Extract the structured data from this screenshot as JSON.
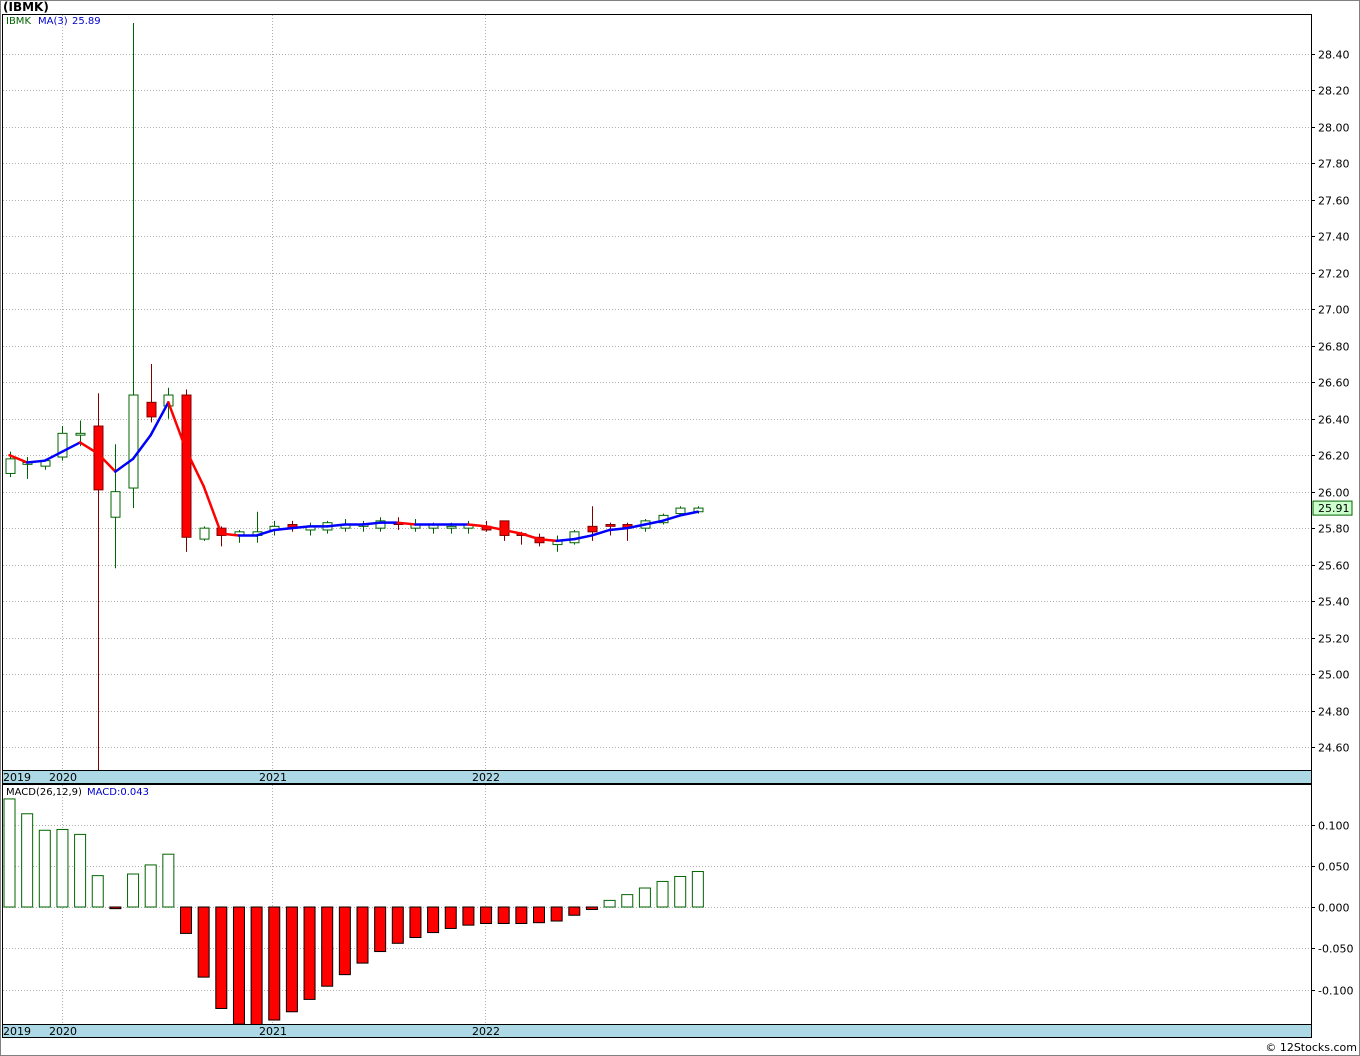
{
  "title": "(IBMK)",
  "watermark": "© 12Stocks.com",
  "colors": {
    "up_body": "#ffffff",
    "up_border": "#006400",
    "down_body": "#ff0000",
    "down_border": "#800000",
    "ma_up": "#0000ff",
    "ma_down": "#ff0000",
    "macd_pos_border": "#006400",
    "macd_neg_fill": "#ff0000",
    "grid": "#b0b0b0",
    "axis_band": "#add8e6",
    "last_price_bg": "#ccffcc"
  },
  "chart_data": [
    {
      "type": "candlestick",
      "panel": "price",
      "ticker_label": "IBMK",
      "ma_label": "MA(3)",
      "ma_value": "25.89",
      "last_price": "25.91",
      "ylim": [
        24.47,
        28.62
      ],
      "y_ticks": [
        "24.60",
        "24.80",
        "25.00",
        "25.20",
        "25.40",
        "25.60",
        "25.80",
        "26.00",
        "26.20",
        "26.40",
        "26.60",
        "26.80",
        "27.00",
        "27.20",
        "27.40",
        "27.60",
        "27.80",
        "28.00",
        "28.20",
        "28.40"
      ],
      "x_labels": [
        "2019",
        "2020",
        "2021",
        "2022"
      ],
      "grid": true,
      "candles": [
        {
          "o": 26.1,
          "h": 26.22,
          "l": 26.08,
          "c": 26.18
        },
        {
          "o": 26.15,
          "h": 26.19,
          "l": 26.07,
          "c": 26.16
        },
        {
          "o": 26.14,
          "h": 26.18,
          "l": 26.12,
          "c": 26.17
        },
        {
          "o": 26.19,
          "h": 26.36,
          "l": 26.17,
          "c": 26.32
        },
        {
          "o": 26.31,
          "h": 26.39,
          "l": 26.25,
          "c": 26.32
        },
        {
          "o": 26.36,
          "h": 26.54,
          "l": 24.47,
          "c": 26.01
        },
        {
          "o": 25.86,
          "h": 26.26,
          "l": 25.58,
          "c": 26.0
        },
        {
          "o": 26.02,
          "h": 28.57,
          "l": 25.91,
          "c": 26.53
        },
        {
          "o": 26.49,
          "h": 26.7,
          "l": 26.38,
          "c": 26.41
        },
        {
          "o": 26.47,
          "h": 26.57,
          "l": 26.4,
          "c": 26.53
        },
        {
          "o": 26.53,
          "h": 26.56,
          "l": 25.67,
          "c": 25.75
        },
        {
          "o": 25.74,
          "h": 25.81,
          "l": 25.73,
          "c": 25.8
        },
        {
          "o": 25.8,
          "h": 25.81,
          "l": 25.7,
          "c": 25.76
        },
        {
          "o": 25.76,
          "h": 25.79,
          "l": 25.72,
          "c": 25.78
        },
        {
          "o": 25.76,
          "h": 25.89,
          "l": 25.72,
          "c": 25.78
        },
        {
          "o": 25.79,
          "h": 25.84,
          "l": 25.76,
          "c": 25.81
        },
        {
          "o": 25.82,
          "h": 25.84,
          "l": 25.78,
          "c": 25.8
        },
        {
          "o": 25.79,
          "h": 25.83,
          "l": 25.76,
          "c": 25.81
        },
        {
          "o": 25.79,
          "h": 25.84,
          "l": 25.77,
          "c": 25.83
        },
        {
          "o": 25.8,
          "h": 25.85,
          "l": 25.78,
          "c": 25.82
        },
        {
          "o": 25.81,
          "h": 25.84,
          "l": 25.78,
          "c": 25.82
        },
        {
          "o": 25.8,
          "h": 25.86,
          "l": 25.78,
          "c": 25.84
        },
        {
          "o": 25.83,
          "h": 25.86,
          "l": 25.79,
          "c": 25.82
        },
        {
          "o": 25.8,
          "h": 25.85,
          "l": 25.78,
          "c": 25.82
        },
        {
          "o": 25.8,
          "h": 25.83,
          "l": 25.77,
          "c": 25.82
        },
        {
          "o": 25.8,
          "h": 25.83,
          "l": 25.77,
          "c": 25.81
        },
        {
          "o": 25.8,
          "h": 25.84,
          "l": 25.77,
          "c": 25.82
        },
        {
          "o": 25.81,
          "h": 25.84,
          "l": 25.78,
          "c": 25.79
        },
        {
          "o": 25.84,
          "h": 25.84,
          "l": 25.73,
          "c": 25.76
        },
        {
          "o": 25.77,
          "h": 25.78,
          "l": 25.71,
          "c": 25.76
        },
        {
          "o": 25.75,
          "h": 25.77,
          "l": 25.7,
          "c": 25.72
        },
        {
          "o": 25.71,
          "h": 25.76,
          "l": 25.67,
          "c": 25.73
        },
        {
          "o": 25.72,
          "h": 25.79,
          "l": 25.71,
          "c": 25.78
        },
        {
          "o": 25.81,
          "h": 25.92,
          "l": 25.73,
          "c": 25.78
        },
        {
          "o": 25.82,
          "h": 25.83,
          "l": 25.76,
          "c": 25.81
        },
        {
          "o": 25.82,
          "h": 25.83,
          "l": 25.73,
          "c": 25.8
        },
        {
          "o": 25.8,
          "h": 25.85,
          "l": 25.78,
          "c": 25.84
        },
        {
          "o": 25.83,
          "h": 25.88,
          "l": 25.82,
          "c": 25.87
        },
        {
          "o": 25.88,
          "h": 25.92,
          "l": 25.87,
          "c": 25.91
        },
        {
          "o": 25.89,
          "h": 25.92,
          "l": 25.88,
          "c": 25.91
        }
      ],
      "ma3": [
        26.2,
        26.16,
        26.17,
        26.22,
        26.27,
        26.21,
        26.11,
        26.18,
        26.31,
        26.49,
        26.23,
        26.03,
        25.77,
        25.76,
        25.76,
        25.79,
        25.8,
        25.81,
        25.81,
        25.82,
        25.82,
        25.83,
        25.83,
        25.82,
        25.82,
        25.82,
        25.82,
        25.81,
        25.79,
        25.77,
        25.74,
        25.73,
        25.74,
        25.76,
        25.79,
        25.8,
        25.82,
        25.84,
        25.87,
        25.89
      ]
    },
    {
      "type": "bar",
      "panel": "macd",
      "label": "MACD(26,12,9)",
      "value_label": "MACD:0.043",
      "ylim": [
        -0.14,
        0.13
      ],
      "y_ticks": [
        "-0.100",
        "-0.050",
        "0.000",
        "0.050",
        "0.100"
      ],
      "x_labels": [
        "2019",
        "2020",
        "2021",
        "2022"
      ],
      "values": [
        0.131,
        0.113,
        0.093,
        0.094,
        0.088,
        0.038,
        -0.002,
        0.04,
        0.051,
        0.064,
        -0.032,
        -0.085,
        -0.123,
        -0.142,
        -0.145,
        -0.137,
        -0.127,
        -0.112,
        -0.096,
        -0.082,
        -0.068,
        -0.054,
        -0.044,
        -0.037,
        -0.031,
        -0.026,
        -0.022,
        -0.02,
        -0.02,
        -0.02,
        -0.019,
        -0.017,
        -0.01,
        -0.003,
        0.008,
        0.015,
        0.023,
        0.031,
        0.037,
        0.043
      ]
    }
  ]
}
